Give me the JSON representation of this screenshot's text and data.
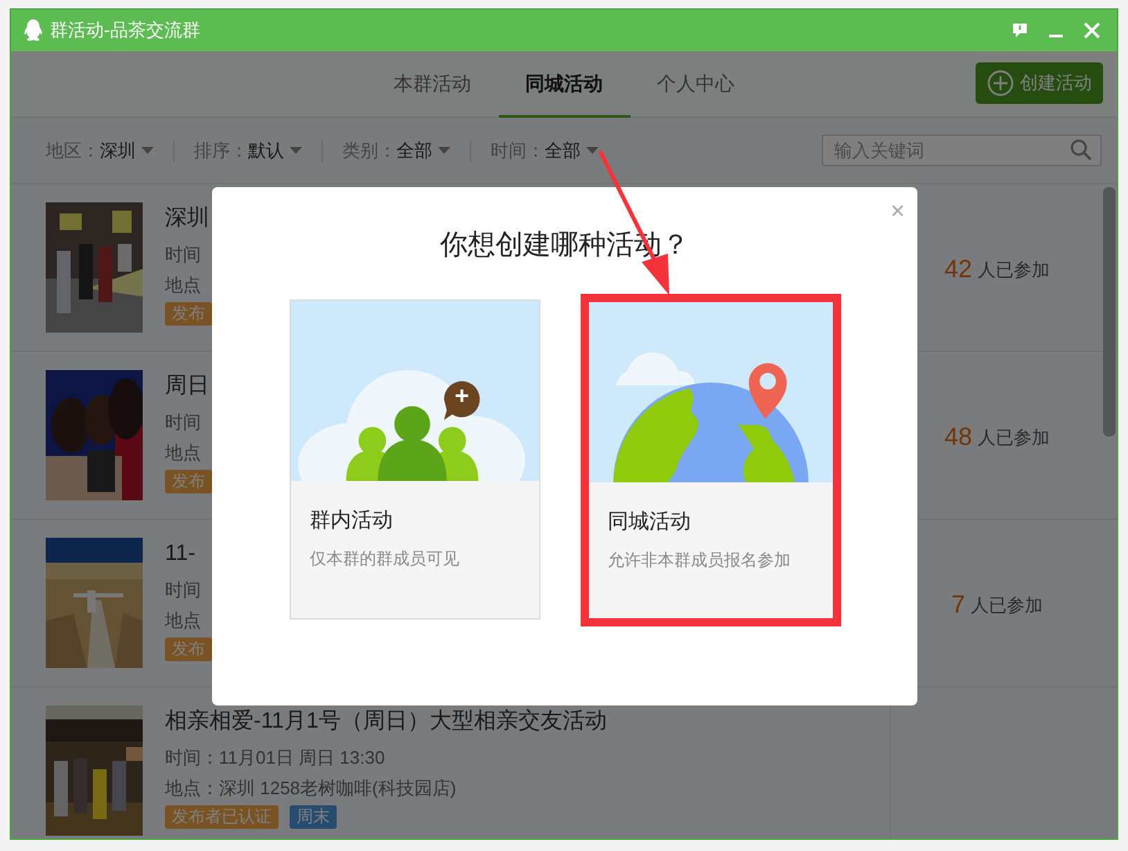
{
  "window": {
    "title": "群活动-品茶交流群"
  },
  "tabs": [
    {
      "label": "本群活动",
      "selected": false
    },
    {
      "label": "同城活动",
      "selected": true
    },
    {
      "label": "个人中心",
      "selected": false
    }
  ],
  "create_button": {
    "label": "创建活动"
  },
  "filters": [
    {
      "label": "地区：",
      "value": "深圳"
    },
    {
      "label": "排序：",
      "value": "默认"
    },
    {
      "label": "类别：",
      "value": "全部"
    },
    {
      "label": "时间：",
      "value": "全部"
    }
  ],
  "search": {
    "placeholder": "输入关键词"
  },
  "activities": [
    {
      "title": "深圳",
      "time": "时间",
      "location": "地点",
      "tags": [
        {
          "label": "发布",
          "kind": "verified"
        }
      ],
      "count": "42",
      "count_label": "人已参加"
    },
    {
      "title": "周日",
      "time": "时间",
      "location": "地点",
      "tags": [
        {
          "label": "发布",
          "kind": "verified"
        }
      ],
      "count": "48",
      "count_label": "人已参加"
    },
    {
      "title": "11-",
      "time": "时间",
      "location": "地点",
      "tags": [
        {
          "label": "发布",
          "kind": "verified"
        }
      ],
      "count": "7",
      "count_label": "人已参加"
    },
    {
      "title": "相亲相爱-11月1号（周日）大型相亲交友活动",
      "time": "时间：11月01日 周日 13:30",
      "location": "地点：深圳 1258老树咖啡(科技园店)",
      "tags": [
        {
          "label": "发布者已认证",
          "kind": "verified"
        },
        {
          "label": "周末",
          "kind": "weekend"
        }
      ]
    }
  ],
  "dialog": {
    "title": "你想创建哪种活动？",
    "close": "×",
    "options": [
      {
        "title": "群内活动",
        "description": "仅本群的群成员可见",
        "kind": "group",
        "highlighted": false
      },
      {
        "title": "同城活动",
        "description": "允许非本群成员报名参加",
        "kind": "city",
        "highlighted": true
      }
    ]
  }
}
